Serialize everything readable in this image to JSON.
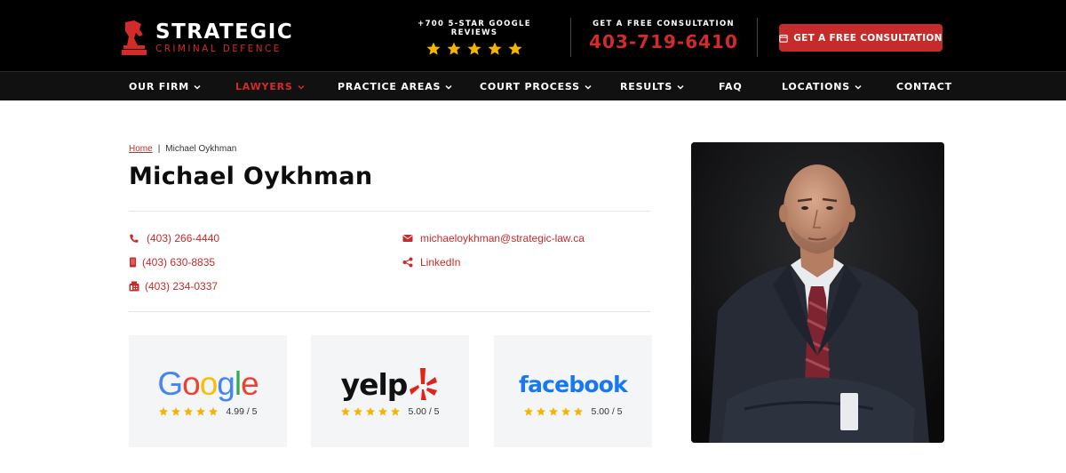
{
  "header": {
    "logo_title": "STRATEGIC",
    "logo_subtitle": "CRIMINAL DEFENCE",
    "reviews_label": "+700 5-STAR GOOGLE REVIEWS",
    "consult_label": "GET A FREE CONSULTATION",
    "consult_phone": "403-719-6410",
    "cta_label": "GET A FREE CONSULTATION",
    "brand_red": "#c62b2b",
    "star_color": "#f5b400"
  },
  "nav": {
    "items": [
      {
        "label": "OUR FIRM",
        "dropdown": true
      },
      {
        "label": "LAWYERS",
        "dropdown": true,
        "active": true
      },
      {
        "label": "PRACTICE AREAS",
        "dropdown": true
      },
      {
        "label": "COURT PROCESS",
        "dropdown": true
      },
      {
        "label": "RESULTS",
        "dropdown": true
      },
      {
        "label": "FAQ",
        "dropdown": false
      },
      {
        "label": "LOCATIONS",
        "dropdown": true
      },
      {
        "label": "CONTACT",
        "dropdown": false
      }
    ]
  },
  "breadcrumb": {
    "home": "Home",
    "separator": "|",
    "current": "Michael Oykhman"
  },
  "profile": {
    "name": "Michael Oykhman",
    "phone": "(403) 266-4440",
    "mobile": "(403) 630-8835",
    "fax": "(403) 234-0337",
    "email": "michaeloykhman@strategic-law.ca",
    "linkedin": "LinkedIn"
  },
  "reviews": [
    {
      "platform": "Google",
      "rating": "4.99 / 5",
      "stars": 5
    },
    {
      "platform": "yelp",
      "rating": "5.00 / 5",
      "stars": 5
    },
    {
      "platform": "facebook",
      "rating": "5.00 / 5",
      "stars": 5
    }
  ],
  "icons": [
    "chess-knight-logo-icon",
    "star-icon",
    "calendar-icon",
    "chevron-down-icon",
    "phone-icon",
    "mobile-icon",
    "fax-icon",
    "email-icon",
    "share-icon",
    "yelp-burst-icon"
  ]
}
